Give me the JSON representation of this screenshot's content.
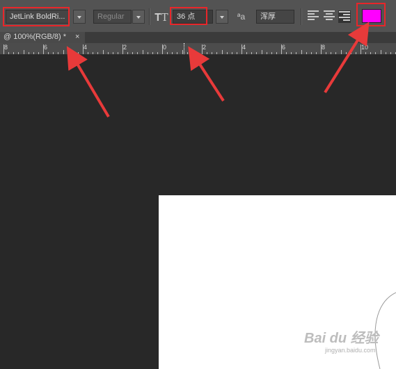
{
  "options_bar": {
    "font_family": "JetLink BoldRi...",
    "font_style": "Regular",
    "font_size_icon": "𝐓T",
    "font_size": "36 点",
    "antialias_icon": "ªa",
    "antialias": "浑厚",
    "text_color": "#ff00ff"
  },
  "document_tab": {
    "title": "@ 100%(RGB/8) *",
    "close": "×"
  },
  "ruler": {
    "labels": [
      "8",
      "6",
      "4",
      "2",
      "0",
      "2",
      "4",
      "6",
      "8",
      "10"
    ]
  },
  "watermark": {
    "brand": "Bai du 经验",
    "url": "jingyan.baidu.com"
  },
  "colors": {
    "highlight": "#e8262a",
    "arrow": "#e83a3a"
  }
}
